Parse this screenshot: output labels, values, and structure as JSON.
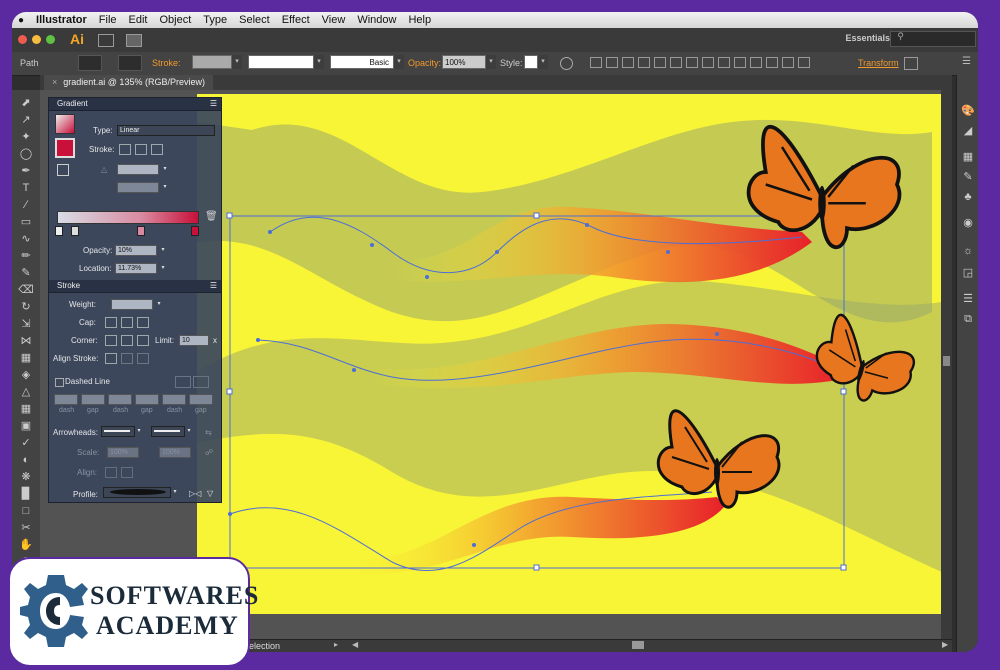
{
  "menu": {
    "apple_icon": "apple-icon",
    "app_name": "Illustrator",
    "items": [
      "File",
      "Edit",
      "Object",
      "Type",
      "Select",
      "Effect",
      "View",
      "Window",
      "Help"
    ]
  },
  "appbar": {
    "logo": "Ai",
    "workspace": "Essentials"
  },
  "control": {
    "selection_type": "Path",
    "stroke_label": "Stroke:",
    "brush_profile": "Basic",
    "opacity_label": "Opacity:",
    "opacity_value": "100%",
    "style_label": "Style:",
    "transform_label": "Transform"
  },
  "document": {
    "tab_title": "gradient.ai @ 135% (RGB/Preview)"
  },
  "gradient_panel": {
    "title": "Gradient",
    "type_label": "Type:",
    "type_value": "Linear",
    "stroke_label": "Stroke:",
    "opacity_label": "Opacity:",
    "opacity_value": "10%",
    "location_label": "Location:",
    "location_value": "11.73%"
  },
  "stroke_panel": {
    "title": "Stroke",
    "weight_label": "Weight:",
    "cap_label": "Cap:",
    "corner_label": "Corner:",
    "limit_label": "Limit:",
    "limit_value": "10",
    "limit_unit": "x",
    "align_label": "Align Stroke:",
    "dashed_label": "Dashed Line",
    "dash_labels": [
      "dash",
      "gap",
      "dash",
      "gap",
      "dash",
      "gap"
    ],
    "arrowheads_label": "Arrowheads:",
    "scale_label": "Scale:",
    "scale_value_1": "100%",
    "scale_value_2": "100%",
    "align_arrow_label": "Align:",
    "profile_label": "Profile:"
  },
  "status": {
    "tool_name": "Selection"
  },
  "watermark": {
    "line1": "SOFTWARES",
    "line2": "ACADEMY"
  },
  "colors": {
    "artboard": "#f8f436",
    "accent_orange": "#f29a2e",
    "gradient_end": "#c8103a",
    "frame_purple": "#5b2aa0"
  }
}
